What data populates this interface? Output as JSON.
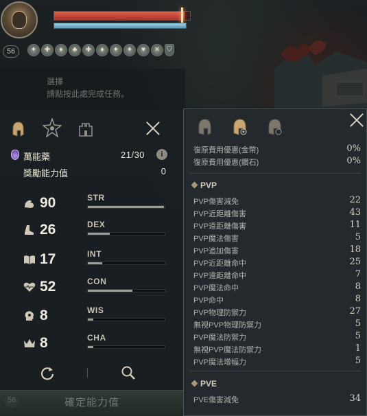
{
  "hud": {
    "level": "56",
    "hp_fraction": 0.96,
    "mp_fraction": 1.0,
    "buffs": [
      "buff-icon",
      "buff-icon",
      "buff-icon",
      "buff-icon",
      "buff-icon",
      "buff-icon",
      "buff-icon",
      "buff-icon",
      "buff-icon",
      "buff-icon",
      "buff-icon"
    ]
  },
  "background": {
    "quest_title": "選擇",
    "quest_hint": "請點按此處完成任務。"
  },
  "left_panel": {
    "elixir": {
      "label": "萬能藥",
      "count": "21/30",
      "info": "i"
    },
    "bonus": {
      "label": "獎勵能力值",
      "value": "0"
    },
    "stats": [
      {
        "icon": "strength-arm-icon",
        "value": "90",
        "name": "STR",
        "fill": 0.99
      },
      {
        "icon": "dexterity-boot-icon",
        "value": "26",
        "name": "DEX",
        "fill": 0.29
      },
      {
        "icon": "intelligence-book-icon",
        "value": "17",
        "name": "INT",
        "fill": 0.19
      },
      {
        "icon": "constitution-heart-icon",
        "value": "52",
        "name": "CON",
        "fill": 0.58
      },
      {
        "icon": "wisdom-head-icon",
        "value": "8",
        "name": "WIS",
        "fill": 0.07
      },
      {
        "icon": "charisma-crown-icon",
        "value": "8",
        "name": "CHA",
        "fill": 0.07
      }
    ],
    "confirm_label": "確定能力值"
  },
  "right_panel": {
    "top_rows": [
      {
        "label": "復原費用優惠(金幣)",
        "value": "0%"
      },
      {
        "label": "復原費用優惠(鑽石)",
        "value": "0%"
      }
    ],
    "pvp_title": "PVP",
    "pvp_rows": [
      {
        "label": "PVP傷害減免",
        "value": "22"
      },
      {
        "label": "PVP近距離傷害",
        "value": "43"
      },
      {
        "label": "PVP遠距離傷害",
        "value": "11"
      },
      {
        "label": "PVP魔法傷害",
        "value": "5"
      },
      {
        "label": "PVP追加傷害",
        "value": "18"
      },
      {
        "label": "PVP近距離命中",
        "value": "25"
      },
      {
        "label": "PVP遠距離命中",
        "value": "7"
      },
      {
        "label": "PVP魔法命中",
        "value": "8"
      },
      {
        "label": "PVP命中",
        "value": "8"
      },
      {
        "label": "PVP物理防禦力",
        "value": "27"
      },
      {
        "label": "無視PVP物理防禦力",
        "value": "5"
      },
      {
        "label": "PVP魔法防禦力",
        "value": "5"
      },
      {
        "label": "無視PVP魔法防禦力",
        "value": "1"
      },
      {
        "label": "PVP魔法增幅力",
        "value": "5"
      }
    ],
    "pve_title": "PVE",
    "pve_rows": [
      {
        "label": "PVE傷害減免",
        "value": "34"
      }
    ]
  },
  "colors": {
    "hp": "#c9463a",
    "mp": "#7bb6d0",
    "panel_bg": "#23292c",
    "accent_gold": "#a89978"
  }
}
